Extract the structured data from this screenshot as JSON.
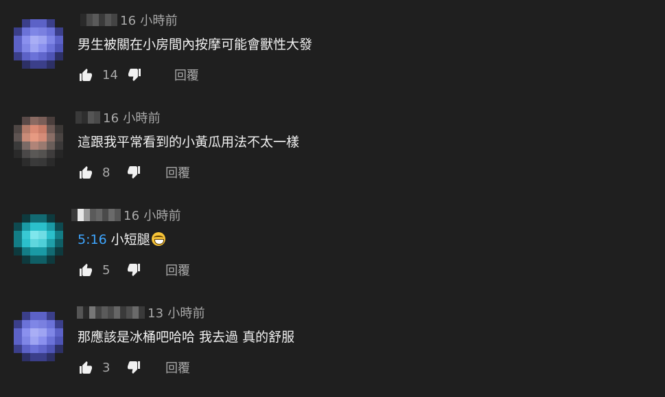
{
  "comments": [
    {
      "time": "16 小時前",
      "text": "男生被關在小房間內按摩可能會獸性大發",
      "timestamp_link": "",
      "has_emoji": false,
      "likes": "14",
      "reply_label": "回覆",
      "avatar_palette": [
        "#1f1f1f",
        "#3b3f8a",
        "#5c62c7",
        "#5c62c7",
        "#3b3f8a",
        "#1f1f1f",
        "#3b3f8a",
        "#6b72d8",
        "#7f86e6",
        "#7a80e0",
        "#6b72d8",
        "#3b3f8a",
        "#5c62c7",
        "#8a90ee",
        "#a9aef5",
        "#9ea4f2",
        "#7f86e6",
        "#5c62c7",
        "#5c62c7",
        "#7f86e6",
        "#9ea4f2",
        "#8a90ee",
        "#6b72d8",
        "#4e54b5",
        "#3b3f8a",
        "#5c62c7",
        "#6b72d8",
        "#6066cc",
        "#4e54b5",
        "#2d3066",
        "#1f1f1f",
        "#2d3066",
        "#3b3f8a",
        "#3b3f8a",
        "#2d3066",
        "#1f1f1f"
      ],
      "name_blocks": [
        "#2a2a2a",
        "#4a4a4a",
        "#5a5a5a",
        "#3a3a3a",
        "#555555",
        "#444444"
      ]
    },
    {
      "time": "16 小時前",
      "text": "這跟我平常看到的小黃瓜用法不太一樣",
      "timestamp_link": "",
      "has_emoji": false,
      "likes": "8",
      "reply_label": "回覆",
      "avatar_palette": [
        "#1f1f1f",
        "#5a4a48",
        "#8a6a62",
        "#7a5e58",
        "#4a3e3c",
        "#1f1f1f",
        "#4e4644",
        "#b37b6a",
        "#d98a74",
        "#c77c68",
        "#6e5a55",
        "#3c3836",
        "#5e5452",
        "#c98b78",
        "#e69a82",
        "#d58c78",
        "#8a6e66",
        "#4a4442",
        "#3a3a3a",
        "#7a6a66",
        "#b08478",
        "#9a7a70",
        "#6a5e5a",
        "#3a3838",
        "#2a2a2a",
        "#4a4848",
        "#5a5856",
        "#545250",
        "#3e3c3c",
        "#262626",
        "#1f1f1f",
        "#2c2c2c",
        "#3a3a3a",
        "#383838",
        "#2a2a2a",
        "#1f1f1f"
      ],
      "name_blocks": [
        "#3a3a3a",
        "#2e2e2e",
        "#555555",
        "#4a4a4a"
      ]
    },
    {
      "time": "16 小時前",
      "text": "小短腿",
      "timestamp_link": "5:16",
      "has_emoji": true,
      "likes": "5",
      "reply_label": "回覆",
      "avatar_palette": [
        "#1f1f1f",
        "#0e3a3e",
        "#126a72",
        "#126a72",
        "#0e3a3e",
        "#1f1f1f",
        "#0e4a50",
        "#1a9aa5",
        "#2bc0cb",
        "#2bc0cb",
        "#1a9aa5",
        "#0e4a50",
        "#137d86",
        "#38c9d3",
        "#7fe6ec",
        "#6fdde4",
        "#2bc0cb",
        "#137d86",
        "#137d86",
        "#2bc0cb",
        "#5fd6de",
        "#4fcfd8",
        "#1f9fa9",
        "#0f5f66",
        "#0e3a3e",
        "#137d86",
        "#1a9aa5",
        "#1a9aa5",
        "#126a72",
        "#0e3a3e",
        "#1f1f1f",
        "#0e3a3e",
        "#0f5f66",
        "#0f5f66",
        "#0e3a3e",
        "#1f1f1f"
      ],
      "name_blocks": [
        "#3a3a3a",
        "#e8e8e8",
        "#9a9a9a",
        "#5a5a5a",
        "#666666",
        "#4a4a4a",
        "#6a6a6a",
        "#555555"
      ]
    },
    {
      "time": "13 小時前",
      "text": "那應該是冰桶吧哈哈 我去過 真的舒服",
      "timestamp_link": "",
      "has_emoji": false,
      "likes": "3",
      "reply_label": "回覆",
      "avatar_palette": [
        "#1f1f1f",
        "#3b3f8a",
        "#5c62c7",
        "#5c62c7",
        "#3b3f8a",
        "#1f1f1f",
        "#3b3f8a",
        "#6b72d8",
        "#7f86e6",
        "#7a80e0",
        "#6b72d8",
        "#3b3f8a",
        "#5c62c7",
        "#8a90ee",
        "#a9aef5",
        "#9ea4f2",
        "#7f86e6",
        "#5c62c7",
        "#5c62c7",
        "#7f86e6",
        "#9ea4f2",
        "#8a90ee",
        "#6b72d8",
        "#4e54b5",
        "#3b3f8a",
        "#5c62c7",
        "#6b72d8",
        "#6066cc",
        "#4e54b5",
        "#2d3066",
        "#1f1f1f",
        "#2d3066",
        "#3b3f8a",
        "#3b3f8a",
        "#2d3066",
        "#1f1f1f"
      ],
      "name_blocks": [
        "#555555",
        "#2a2a2a",
        "#777777",
        "#444444",
        "#5a5a5a",
        "#4a4a4a",
        "#666666",
        "#3a3a3a",
        "#4e4e4e",
        "#6a6a6a",
        "#3a3a3a"
      ]
    }
  ],
  "colors": {
    "background": "#1f1f1f",
    "primary_text": "#f1f1f1",
    "secondary_text": "#aaaaaa",
    "link": "#3ea6ff"
  },
  "icons": {
    "like": "thumb-up-icon",
    "dislike": "thumb-down-icon"
  }
}
